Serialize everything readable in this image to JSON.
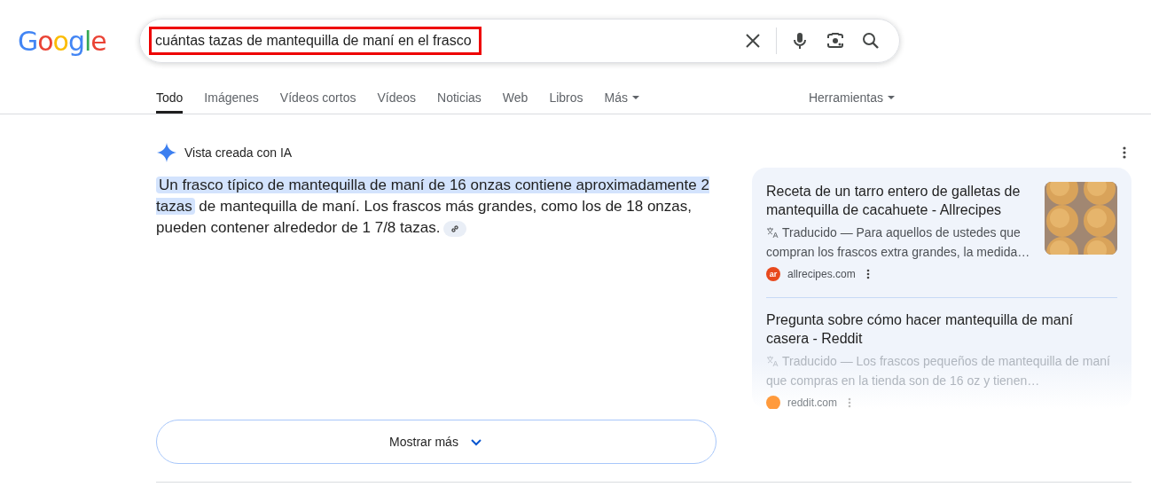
{
  "logo": "Google",
  "search": {
    "value": "cuántas tazas de mantequilla de maní en el frasco"
  },
  "tabs": [
    {
      "label": "Todo",
      "selected": true
    },
    {
      "label": "Imágenes",
      "selected": false
    },
    {
      "label": "Vídeos cortos",
      "selected": false
    },
    {
      "label": "Vídeos",
      "selected": false
    },
    {
      "label": "Noticias",
      "selected": false
    },
    {
      "label": "Web",
      "selected": false
    },
    {
      "label": "Libros",
      "selected": false
    },
    {
      "label": "Más",
      "selected": false,
      "kind": "menu"
    }
  ],
  "tools": "Herramientas",
  "ai_overview": {
    "title": "Vista creada con IA",
    "answer": [
      {
        "text": "Un frasco típico de mantequilla de maní de 16 onzas contiene aproximadamente 2 tazas",
        "highlighted": true
      },
      {
        "text": " de mantequilla de maní. Los frascos más grandes, como los de 18 onzas, pueden contener alrededor de 1 7/8 tazas.",
        "highlighted": false
      }
    ],
    "show_more": "Mostrar más"
  },
  "sources": [
    {
      "title": "Receta de un tarro entero de galletas de mantequilla de cacahuete - Allrecipes",
      "snippet": "Traducido — Para aquellos de ustedes que compran los frascos extra grandes, la medida…",
      "site": "allrecipes.com",
      "favicon": "ar",
      "color": "#e8491d",
      "faded": false
    },
    {
      "title": "Pregunta sobre cómo hacer mantequilla de maní casera - Reddit",
      "snippet": "Traducido — Los frascos pequeños de mantequilla de maní que compras en la tienda son de 16 oz y tienen…",
      "site": "reddit.com",
      "color": "#ff9a3c",
      "faded": true
    }
  ]
}
